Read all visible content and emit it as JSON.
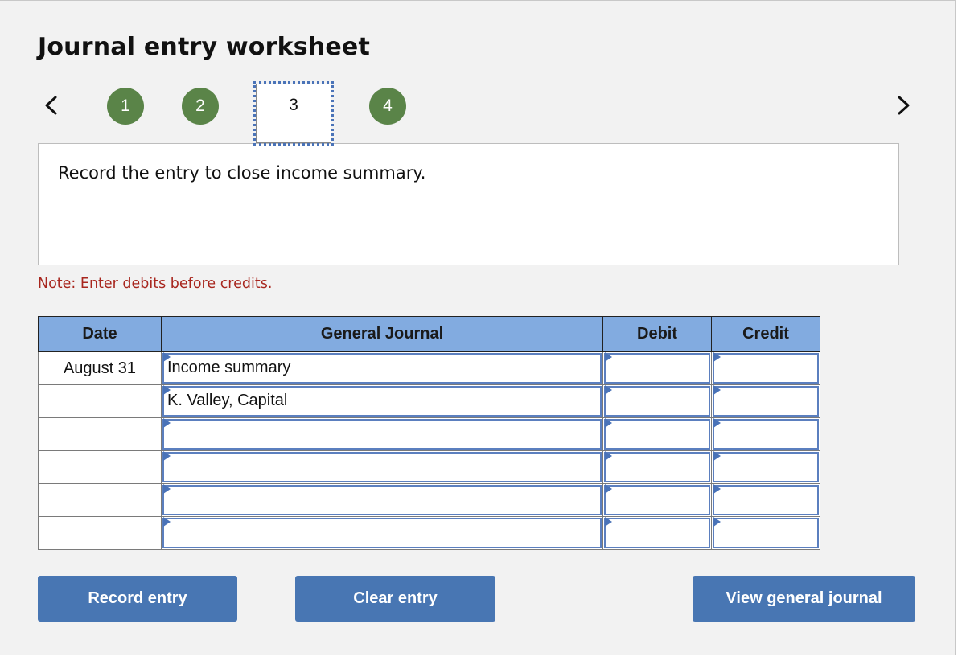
{
  "header": {
    "title": "Journal entry worksheet"
  },
  "stepper": {
    "prev_icon": "chevron-left-icon",
    "next_icon": "chevron-right-icon",
    "steps": [
      {
        "label": "1",
        "state": "completed"
      },
      {
        "label": "2",
        "state": "completed"
      },
      {
        "label": "3",
        "state": "active"
      },
      {
        "label": "4",
        "state": "completed"
      }
    ],
    "colors": {
      "completed": "#5a8448",
      "active_outline": "#4a73b8"
    }
  },
  "prompt": {
    "text": "Record the entry to close income summary."
  },
  "note": {
    "text": "Note: Enter debits before credits.",
    "color": "#a8261e"
  },
  "journal": {
    "headers": {
      "date": "Date",
      "general_journal": "General Journal",
      "debit": "Debit",
      "credit": "Credit"
    },
    "header_color": "#82abe0",
    "rows": [
      {
        "date": "August 31",
        "account": "Income summary",
        "debit": "",
        "credit": ""
      },
      {
        "date": "",
        "account": "K. Valley, Capital",
        "debit": "",
        "credit": ""
      },
      {
        "date": "",
        "account": "",
        "debit": "",
        "credit": ""
      },
      {
        "date": "",
        "account": "",
        "debit": "",
        "credit": ""
      },
      {
        "date": "",
        "account": "",
        "debit": "",
        "credit": ""
      },
      {
        "date": "",
        "account": "",
        "debit": "",
        "credit": ""
      }
    ]
  },
  "buttons": {
    "record": "Record entry",
    "clear": "Clear entry",
    "view_journal": "View general journal",
    "color": "#4876b3"
  }
}
